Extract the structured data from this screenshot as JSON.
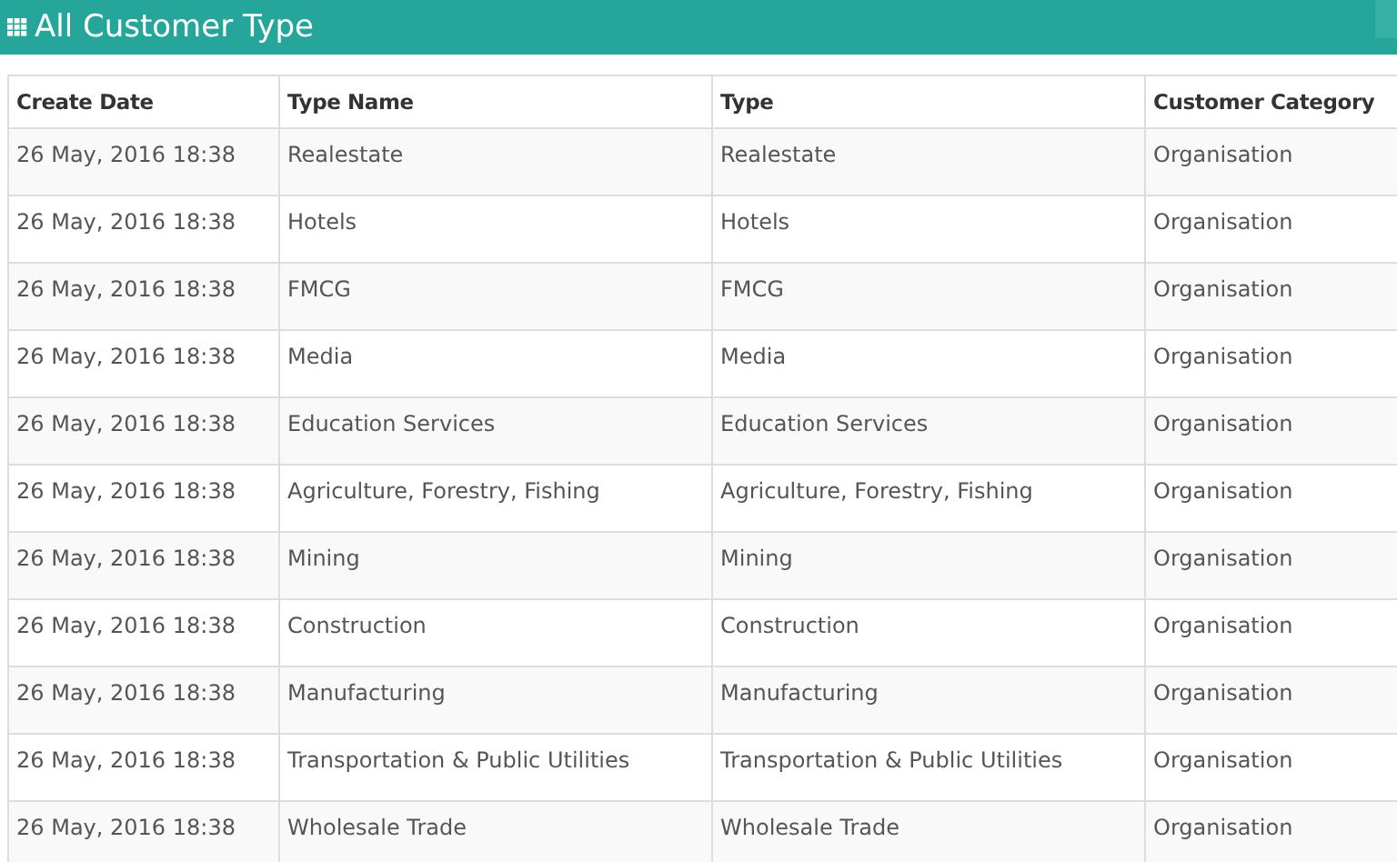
{
  "header": {
    "title": "All Customer Type",
    "button": {
      "kind": "button"
    }
  },
  "table": {
    "columns": [
      "Create Date",
      "Type Name",
      "Type",
      "Customer Category"
    ],
    "rows": [
      [
        "26 May, 2016 18:38",
        "Realestate",
        "Realestate",
        "Organisation"
      ],
      [
        "26 May, 2016 18:38",
        "Hotels",
        "Hotels",
        "Organisation"
      ],
      [
        "26 May, 2016 18:38",
        "FMCG",
        "FMCG",
        "Organisation"
      ],
      [
        "26 May, 2016 18:38",
        "Media",
        "Media",
        "Organisation"
      ],
      [
        "26 May, 2016 18:38",
        "Education Services",
        "Education Services",
        "Organisation"
      ],
      [
        "26 May, 2016 18:38",
        "Agriculture, Forestry, Fishing",
        "Agriculture, Forestry, Fishing",
        "Organisation"
      ],
      [
        "26 May, 2016 18:38",
        "Mining",
        "Mining",
        "Organisation"
      ],
      [
        "26 May, 2016 18:38",
        "Construction",
        "Construction",
        "Organisation"
      ],
      [
        "26 May, 2016 18:38",
        "Manufacturing",
        "Manufacturing",
        "Organisation"
      ],
      [
        "26 May, 2016 18:38",
        "Transportation & Public Utilities",
        "Transportation & Public Utilities",
        "Organisation"
      ],
      [
        "26 May, 2016 18:38",
        "Wholesale Trade",
        "Wholesale Trade",
        "Organisation"
      ]
    ]
  }
}
